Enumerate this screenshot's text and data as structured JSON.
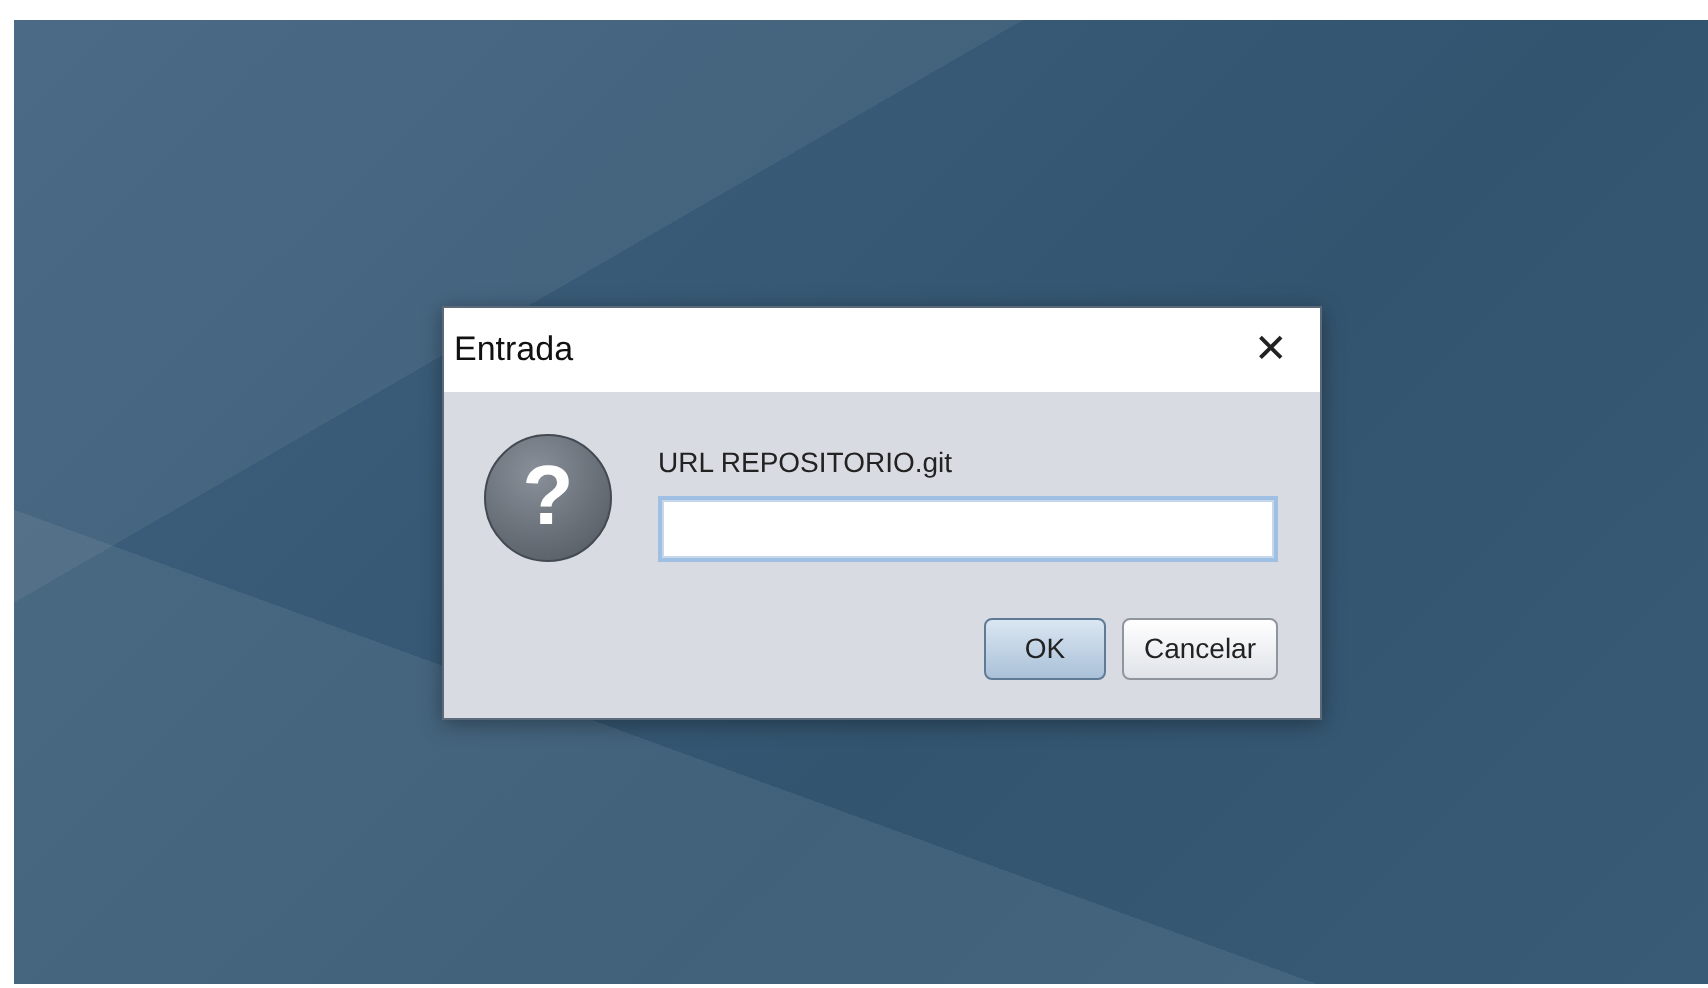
{
  "dialog": {
    "title": "Entrada",
    "close_glyph": "✕",
    "icon_glyph": "?",
    "prompt": "URL REPOSITORIO.git",
    "field": {
      "focused": true
    },
    "buttons": [
      {
        "label": "OK",
        "default": true
      },
      {
        "label": "Cancelar",
        "default": false
      }
    ]
  }
}
